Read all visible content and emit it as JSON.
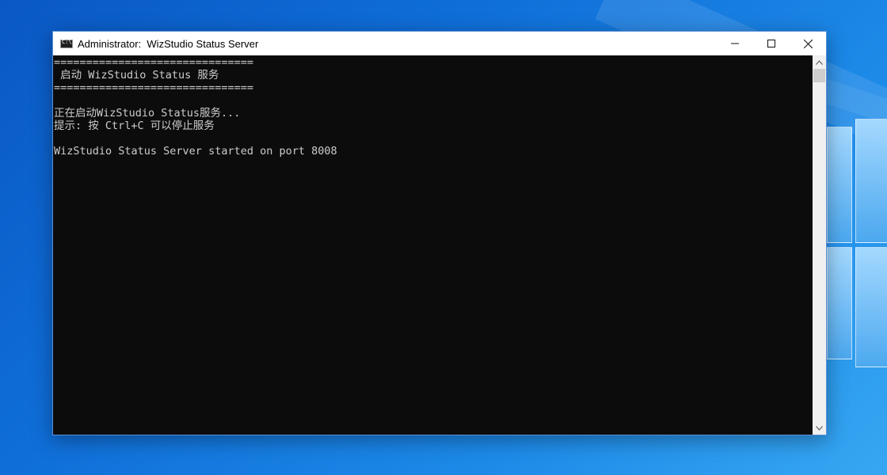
{
  "window": {
    "title": "Administrator:  WizStudio Status Server",
    "controls": {
      "minimize_icon": "minimize-icon",
      "maximize_icon": "maximize-icon",
      "close_icon": "close-icon"
    }
  },
  "console": {
    "lines": [
      "===============================",
      " 启动 WizStudio Status 服务",
      "===============================",
      "",
      "正在启动WizStudio Status服务...",
      "提示: 按 Ctrl+C 可以停止服务",
      "",
      "WizStudio Status Server started on port 8008"
    ]
  },
  "colors": {
    "console_bg": "#0c0c0c",
    "console_text": "#cccccc",
    "titlebar_bg": "#ffffff",
    "desktop_accent": "#0f6ed8"
  }
}
